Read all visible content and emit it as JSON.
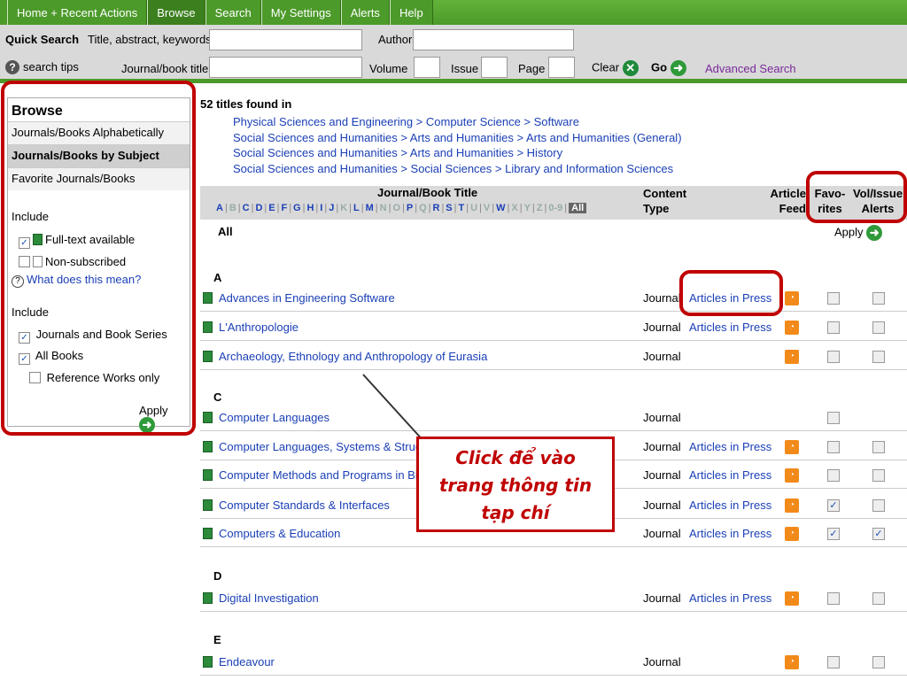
{
  "nav": {
    "tabs": [
      {
        "label": "Home + Recent Actions",
        "active": false
      },
      {
        "label": "Browse",
        "active": true
      },
      {
        "label": "Search",
        "active": false
      },
      {
        "label": "My Settings",
        "active": false
      },
      {
        "label": "Alerts",
        "active": false
      },
      {
        "label": "Help",
        "active": false
      }
    ]
  },
  "quick_search": {
    "label": "Quick Search",
    "title_label": "Title, abstract, keywords",
    "author_label": "Author",
    "search_tips": "search tips",
    "journal_label": "Journal/book title",
    "volume_label": "Volume",
    "issue_label": "Issue",
    "page_label": "Page",
    "clear_label": "Clear",
    "go_label": "Go",
    "advanced_label": "Advanced Search"
  },
  "sidebar": {
    "title": "Browse",
    "items": [
      {
        "label": "Journals/Books Alphabetically",
        "active": false
      },
      {
        "label": "Journals/Books by Subject",
        "active": true
      },
      {
        "label": "Favorite Journals/Books",
        "active": false
      }
    ],
    "include1_label": "Include",
    "fulltext_label": "Full-text available",
    "nonsub_label": "Non-subscribed",
    "what_means": "What does this mean?",
    "include2_label": "Include",
    "journals_series": "Journals and Book Series",
    "all_books": "All Books",
    "reference_only": "Reference Works only",
    "apply_label": "Apply"
  },
  "results": {
    "found_text": "52 titles found in",
    "breadcrumbs": [
      "Physical Sciences and Engineering > Computer Science > Software",
      "Social Sciences and Humanities > Arts and Humanities > Arts and Humanities (General)",
      "Social Sciences and Humanities > Arts and Humanities > History",
      "Social Sciences and Humanities > Social Sciences > Library and Information Sciences"
    ],
    "header": {
      "title_col": "Journal/Book Title",
      "content_line1": "Content",
      "content_line2": "Type",
      "article_line1": "Article",
      "article_line2": "Feed",
      "fav_line1": "Favo-",
      "fav_line2": "rites",
      "vol_line1": "Vol/Issue",
      "vol_line2": "Alerts"
    },
    "alphabet": {
      "letters": [
        "A",
        "B",
        "C",
        "D",
        "E",
        "F",
        "G",
        "H",
        "I",
        "J",
        "K",
        "L",
        "M",
        "N",
        "O",
        "P",
        "Q",
        "R",
        "S",
        "T",
        "U",
        "V",
        "W",
        "X",
        "Y",
        "Z",
        "0-9"
      ],
      "enabled": [
        "A",
        "C",
        "D",
        "E",
        "F",
        "G",
        "H",
        "I",
        "J",
        "L",
        "M",
        "P",
        "R",
        "S",
        "T",
        "W"
      ],
      "all_label": "All"
    },
    "all_row": "All",
    "apply_label": "Apply",
    "groups": [
      {
        "letter": "A",
        "rows": [
          {
            "title": "Advances in Engineering Software",
            "type": "Journal",
            "aip": "Articles in Press",
            "rss": true,
            "fav": false,
            "alert": false
          },
          {
            "title": "L'Anthropologie",
            "type": "Journal",
            "aip": "Articles in Press",
            "rss": true,
            "fav": false,
            "alert": false
          },
          {
            "title": "Archaeology, Ethnology and Anthropology of Eurasia",
            "type": "Journal",
            "aip": "",
            "rss": true,
            "fav": false,
            "alert": false
          }
        ]
      },
      {
        "letter": "C",
        "rows": [
          {
            "title": "Computer Languages",
            "type": "Journal",
            "aip": "",
            "rss": false,
            "fav": false,
            "alert": null
          },
          {
            "title": "Computer Languages, Systems & Struc",
            "type": "Journal",
            "aip": "Articles in Press",
            "rss": true,
            "fav": false,
            "alert": false
          },
          {
            "title": "Computer Methods and Programs in Bio",
            "type": "Journal",
            "aip": "Articles in Press",
            "rss": true,
            "fav": false,
            "alert": false
          },
          {
            "title": "Computer Standards & Interfaces",
            "type": "Journal",
            "aip": "Articles in Press",
            "rss": true,
            "fav": true,
            "alert": false
          },
          {
            "title": "Computers & Education",
            "type": "Journal",
            "aip": "Articles in Press",
            "rss": true,
            "fav": true,
            "alert": true
          }
        ]
      },
      {
        "letter": "D",
        "rows": [
          {
            "title": "Digital Investigation",
            "type": "Journal",
            "aip": "Articles in Press",
            "rss": true,
            "fav": false,
            "alert": false
          }
        ]
      },
      {
        "letter": "E",
        "rows": [
          {
            "title": "Endeavour",
            "type": "Journal",
            "aip": "",
            "rss": true,
            "fav": false,
            "alert": false
          }
        ]
      }
    ]
  },
  "callout": {
    "lines": [
      "Click để vào",
      "trang thông tin",
      "tạp chí"
    ]
  },
  "colors": {
    "nav_green": "#4c9a2a",
    "link_blue": "#1a3fb5",
    "annotation_red": "#c00000",
    "rss_orange": "#f28a1a"
  }
}
